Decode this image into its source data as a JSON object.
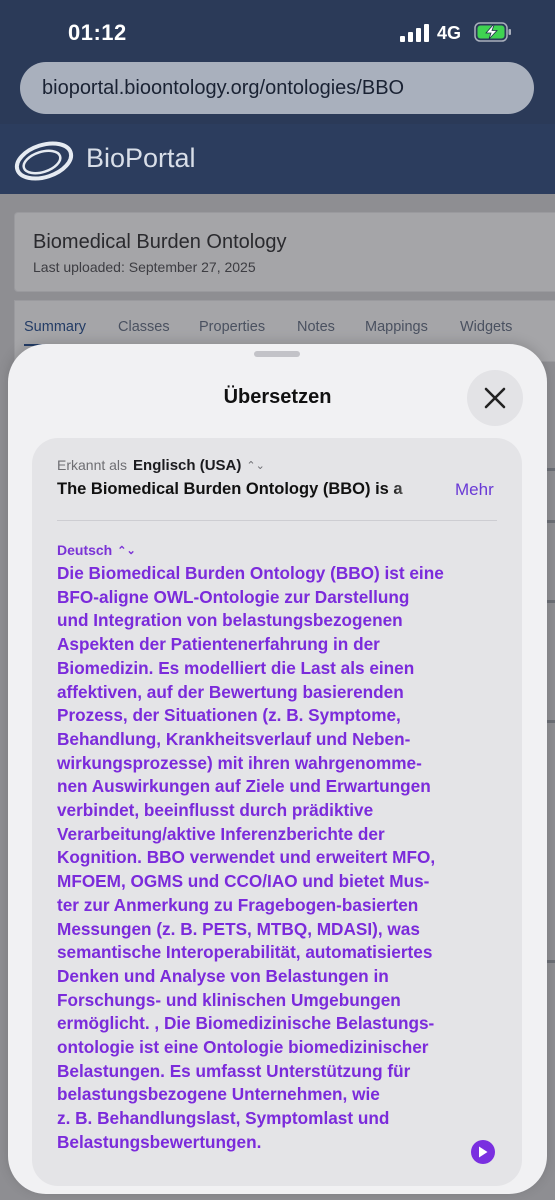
{
  "status_bar": {
    "time": "01:12",
    "network": "4G",
    "icons": [
      "signal-icon",
      "battery-charging-icon"
    ]
  },
  "browser": {
    "url": "bioportal.bioontology.org/ontologies/BBO"
  },
  "site": {
    "logo_text": "BioPortal"
  },
  "ontology": {
    "title": "Biomedical Burden Ontology",
    "last_uploaded": "Last uploaded: September 27, 2025"
  },
  "tabs": [
    "Summary",
    "Classes",
    "Properties",
    "Notes",
    "Mappings",
    "Widgets"
  ],
  "translate_sheet": {
    "title": "Übersetzen",
    "detected_label": "Erkannt als",
    "detected_language": "Englisch (USA)",
    "source_text": "The Biomedical Burden Ontology (BBO) is a",
    "more_label": "Mehr",
    "target_language": "Deutsch",
    "translation_lines": [
      "Die Biomedical Burden Ontology (BBO) ist eine",
      "BFO-aligne OWL-Ontologie zur Darstellung",
      "und Integration von belastungsbezogenen",
      "Aspekten der Patientenerfahrung in der",
      "Biomedizin. Es modelliert die Last als einen",
      "affektiven, auf der Bewertung basierenden",
      "Prozess, der Situationen (z. B. Symptome,",
      "Behandlung, Krankheitsverlauf und Neben-",
      "wirkungsprozesse) mit ihren wahrgenomme-",
      "nen Auswirkungen auf Ziele und Erwartungen",
      "verbindet, beeinflusst durch prädiktive",
      "Verarbeitung/aktive Inferenzberichte der",
      "Kognition. BBO verwendet und erweitert MFO,",
      "MFOEM, OGMS und CCO/IAO und bietet Mus-",
      "ter zur Anmerkung zu Fragebogen-basierten",
      "Messungen (z. B. PETS, MTBQ, MDASI), was",
      "semantische Interoperabilität, automatisiertes",
      "Denken und Analyse von Belastungen in",
      "Forschungs- und klinischen Umgebungen",
      "ermöglicht. , Die Biomedizinische Belastungs-",
      "ontologie ist eine Ontologie biomedizinischer",
      "Belastungen. Es umfasst Unterstützung für",
      "belastungsbezogene Unternehmen, wie",
      "z. B. Behandlungslast, Symptomlast und",
      "Belastungsbewertungen."
    ],
    "colors": {
      "accent": "#7b2bdb",
      "sheet": "#f1f1f3",
      "card": "#e4e4e7"
    }
  }
}
